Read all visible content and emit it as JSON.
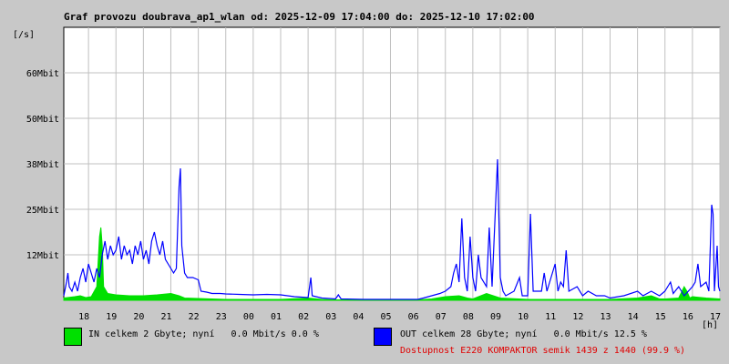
{
  "chart_data": {
    "type": "area",
    "title": "Graf provozu doubrava_ap1_wlan od: 2025-12-09 17:04:00 do: 2025-12-10 17:02:00",
    "ylabel": "[/s]",
    "xlabel": "[h]",
    "yticks": [
      "12Mbit",
      "25Mbit",
      "38Mbit",
      "50Mbit",
      "60Mbit"
    ],
    "ytick_values": [
      10,
      20,
      30,
      40,
      50
    ],
    "ylim": [
      0,
      60
    ],
    "xlim": [
      17.1,
      41.0
    ],
    "xticks": [
      "18",
      "19",
      "20",
      "21",
      "22",
      "23",
      "00",
      "01",
      "02",
      "03",
      "04",
      "05",
      "06",
      "07",
      "08",
      "09",
      "10",
      "11",
      "12",
      "13",
      "14",
      "15",
      "16",
      "17"
    ],
    "grid": true,
    "series": [
      {
        "name": "IN",
        "color": "#00e000",
        "style": "filled",
        "points": [
          [
            17.1,
            0.5
          ],
          [
            17.5,
            0.8
          ],
          [
            17.7,
            1.0
          ],
          [
            17.9,
            0.6
          ],
          [
            18.1,
            0.8
          ],
          [
            18.3,
            3
          ],
          [
            18.4,
            14
          ],
          [
            18.45,
            16
          ],
          [
            18.5,
            12
          ],
          [
            18.55,
            3
          ],
          [
            18.7,
            1.5
          ],
          [
            19,
            1.2
          ],
          [
            19.5,
            1
          ],
          [
            20,
            1
          ],
          [
            20.5,
            1.2
          ],
          [
            21,
            1.5
          ],
          [
            21.3,
            1
          ],
          [
            21.5,
            0.5
          ],
          [
            22,
            0.4
          ],
          [
            22.5,
            0.3
          ],
          [
            23,
            0.2
          ],
          [
            24,
            0.2
          ],
          [
            25,
            0.2
          ],
          [
            26,
            0.5
          ],
          [
            26.5,
            0.2
          ],
          [
            27,
            0.1
          ],
          [
            28,
            0.1
          ],
          [
            29,
            0.1
          ],
          [
            30,
            0.1
          ],
          [
            30.5,
            0.3
          ],
          [
            31,
            0.8
          ],
          [
            31.5,
            1
          ],
          [
            31.8,
            0.5
          ],
          [
            32,
            0.3
          ],
          [
            32.5,
            1.5
          ],
          [
            33,
            0.5
          ],
          [
            34,
            0.2
          ],
          [
            35,
            0.2
          ],
          [
            36,
            0.2
          ],
          [
            37,
            0.2
          ],
          [
            38,
            0.5
          ],
          [
            38.5,
            1
          ],
          [
            38.8,
            0.3
          ],
          [
            39,
            0.3
          ],
          [
            39.5,
            0.5
          ],
          [
            39.7,
            3
          ],
          [
            39.8,
            2
          ],
          [
            39.9,
            0.5
          ],
          [
            40,
            0.8
          ],
          [
            40.5,
            0.5
          ],
          [
            41,
            0.3
          ]
        ]
      },
      {
        "name": "OUT",
        "color": "#0000ff",
        "style": "line",
        "points": [
          [
            17.1,
            1
          ],
          [
            17.2,
            4
          ],
          [
            17.25,
            6
          ],
          [
            17.3,
            3
          ],
          [
            17.4,
            2
          ],
          [
            17.5,
            4
          ],
          [
            17.6,
            2
          ],
          [
            17.7,
            5
          ],
          [
            17.8,
            7
          ],
          [
            17.9,
            4
          ],
          [
            18.0,
            8
          ],
          [
            18.1,
            6
          ],
          [
            18.2,
            4
          ],
          [
            18.3,
            7
          ],
          [
            18.4,
            5
          ],
          [
            18.5,
            10
          ],
          [
            18.6,
            13
          ],
          [
            18.7,
            9
          ],
          [
            18.8,
            12
          ],
          [
            18.9,
            10
          ],
          [
            19.0,
            11
          ],
          [
            19.1,
            14
          ],
          [
            19.2,
            9
          ],
          [
            19.3,
            12
          ],
          [
            19.4,
            10
          ],
          [
            19.5,
            11
          ],
          [
            19.6,
            8
          ],
          [
            19.7,
            12
          ],
          [
            19.8,
            10
          ],
          [
            19.9,
            13
          ],
          [
            20.0,
            9
          ],
          [
            20.1,
            11
          ],
          [
            20.2,
            8
          ],
          [
            20.3,
            13
          ],
          [
            20.4,
            15
          ],
          [
            20.5,
            12
          ],
          [
            20.6,
            10
          ],
          [
            20.7,
            13
          ],
          [
            20.8,
            9
          ],
          [
            20.9,
            8
          ],
          [
            21.0,
            7
          ],
          [
            21.1,
            6
          ],
          [
            21.2,
            7
          ],
          [
            21.3,
            25
          ],
          [
            21.35,
            29
          ],
          [
            21.4,
            12
          ],
          [
            21.5,
            6
          ],
          [
            21.6,
            5
          ],
          [
            21.7,
            5
          ],
          [
            21.8,
            5
          ],
          [
            22.0,
            4.5
          ],
          [
            22.1,
            2
          ],
          [
            22.3,
            1.8
          ],
          [
            22.5,
            1.5
          ],
          [
            22.8,
            1.5
          ],
          [
            23.0,
            1.4
          ],
          [
            23.5,
            1.3
          ],
          [
            24.0,
            1.2
          ],
          [
            24.5,
            1.3
          ],
          [
            25.0,
            1.2
          ],
          [
            25.5,
            0.8
          ],
          [
            26.0,
            0.6
          ],
          [
            26.1,
            5
          ],
          [
            26.15,
            1
          ],
          [
            26.5,
            0.5
          ],
          [
            27.0,
            0.3
          ],
          [
            27.1,
            1.2
          ],
          [
            27.2,
            0.3
          ],
          [
            28.0,
            0.2
          ],
          [
            29.0,
            0.2
          ],
          [
            30.0,
            0.2
          ],
          [
            30.2,
            0.5
          ],
          [
            30.5,
            1
          ],
          [
            30.8,
            1.5
          ],
          [
            31.0,
            2
          ],
          [
            31.2,
            3
          ],
          [
            31.3,
            6
          ],
          [
            31.4,
            8
          ],
          [
            31.5,
            4
          ],
          [
            31.6,
            18
          ],
          [
            31.7,
            5
          ],
          [
            31.8,
            2
          ],
          [
            31.9,
            14
          ],
          [
            32.0,
            5
          ],
          [
            32.1,
            2
          ],
          [
            32.2,
            10
          ],
          [
            32.3,
            5
          ],
          [
            32.5,
            3
          ],
          [
            32.6,
            16
          ],
          [
            32.7,
            3
          ],
          [
            32.9,
            31
          ],
          [
            33.0,
            5
          ],
          [
            33.1,
            2
          ],
          [
            33.2,
            1
          ],
          [
            33.5,
            2
          ],
          [
            33.7,
            5
          ],
          [
            33.8,
            1
          ],
          [
            34.0,
            1
          ],
          [
            34.1,
            19
          ],
          [
            34.2,
            2
          ],
          [
            34.5,
            2
          ],
          [
            34.6,
            6
          ],
          [
            34.7,
            2
          ],
          [
            34.8,
            4
          ],
          [
            35.0,
            8
          ],
          [
            35.1,
            2
          ],
          [
            35.2,
            4
          ],
          [
            35.3,
            3
          ],
          [
            35.4,
            11
          ],
          [
            35.5,
            2
          ],
          [
            35.8,
            3
          ],
          [
            36.0,
            1
          ],
          [
            36.2,
            2
          ],
          [
            36.5,
            1
          ],
          [
            36.8,
            1
          ],
          [
            37.0,
            0.5
          ],
          [
            37.5,
            1
          ],
          [
            38.0,
            2
          ],
          [
            38.2,
            1
          ],
          [
            38.5,
            2
          ],
          [
            38.8,
            1
          ],
          [
            39.0,
            2
          ],
          [
            39.2,
            4
          ],
          [
            39.3,
            1.5
          ],
          [
            39.5,
            3
          ],
          [
            39.7,
            1
          ],
          [
            40.0,
            3
          ],
          [
            40.1,
            4
          ],
          [
            40.2,
            8
          ],
          [
            40.3,
            3
          ],
          [
            40.5,
            4
          ],
          [
            40.6,
            2
          ],
          [
            40.7,
            21
          ],
          [
            40.75,
            19
          ],
          [
            40.8,
            2
          ],
          [
            40.9,
            12
          ],
          [
            40.95,
            3
          ],
          [
            41.0,
            2
          ]
        ]
      }
    ]
  },
  "legend": {
    "in_text": "IN celkem 2 Gbyte; nyní   0.0 Mbit/s 0.0 %",
    "in_color": "#00e000",
    "out_text": "OUT celkem 28 Gbyte; nyní   0.0 Mbit/s 12.5 %",
    "out_color": "#0000ff",
    "availability": "Dostupnost E220 KOMPAKTOR semik 1439 z 1440 (99.9 %)"
  }
}
